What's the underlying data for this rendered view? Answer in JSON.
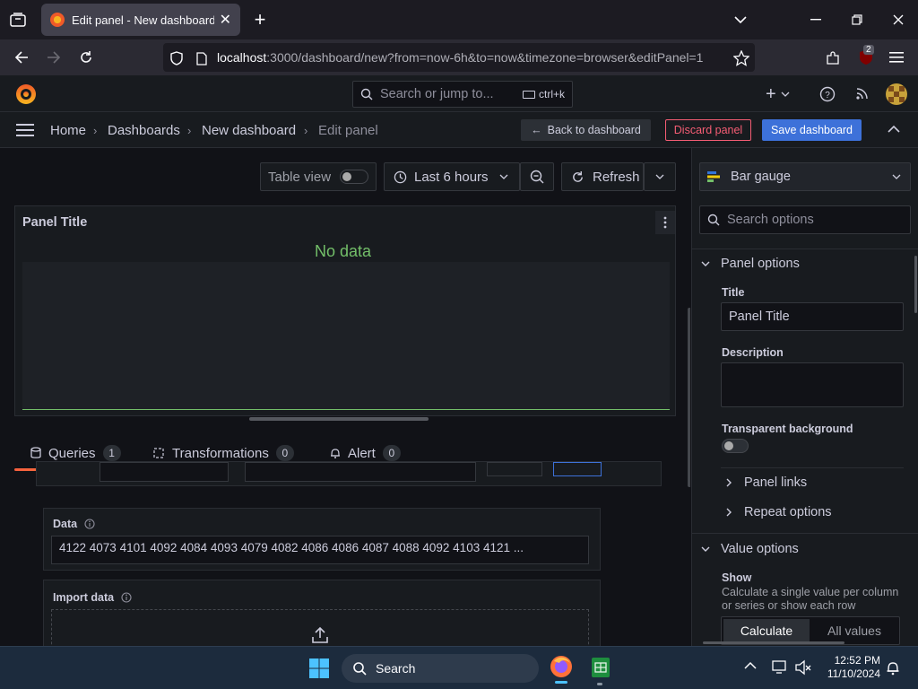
{
  "browser": {
    "tab_title": "Edit panel - New dashboard - D",
    "url_host": "localhost",
    "url_rest": ":3000/dashboard/new?from=now-6h&to=now&timezone=browser&editPanel=1",
    "extension_badge": "2"
  },
  "topbar": {
    "search_placeholder": "Search or jump to...",
    "search_shortcut": "ctrl+k",
    "add_label": "+"
  },
  "breadcrumb": {
    "home": "Home",
    "dashboards": "Dashboards",
    "new_dashboard": "New dashboard",
    "edit_panel": "Edit panel"
  },
  "actions": {
    "back": "Back to dashboard",
    "discard": "Discard panel",
    "save": "Save dashboard"
  },
  "toolbar": {
    "table_view": "Table view",
    "time_range": "Last 6 hours",
    "refresh": "Refresh"
  },
  "panel": {
    "title": "Panel Title",
    "no_data": "No data"
  },
  "query_tabs": [
    {
      "label": "Queries",
      "count": "1"
    },
    {
      "label": "Transformations",
      "count": "0"
    },
    {
      "label": "Alert",
      "count": "0"
    }
  ],
  "query": {
    "data_label": "Data",
    "data_value": "4122 4073 4101 4092 4084 4093 4079 4082 4086 4086 4087 4088 4092 4103 4121 ...",
    "import_label": "Import data"
  },
  "sidebar": {
    "viz": "Bar gauge",
    "search_placeholder": "Search options",
    "panel_options": "Panel options",
    "title_label": "Title",
    "title_value": "Panel Title",
    "description_label": "Description",
    "transparent_label": "Transparent background",
    "panel_links": "Panel links",
    "repeat_options": "Repeat options",
    "value_options": "Value options",
    "show_label": "Show",
    "show_desc": "Calculate a single value per column or series or show each row",
    "calculate": "Calculate",
    "all_values": "All values"
  },
  "taskbar": {
    "search": "Search",
    "time": "12:52 PM",
    "date": "11/10/2024"
  },
  "colors": {
    "accent_blue": "#3d71d9",
    "discard_red": "#f55d74",
    "no_data_green": "#73bf69",
    "query_tab_underline": "#f55f3e"
  }
}
